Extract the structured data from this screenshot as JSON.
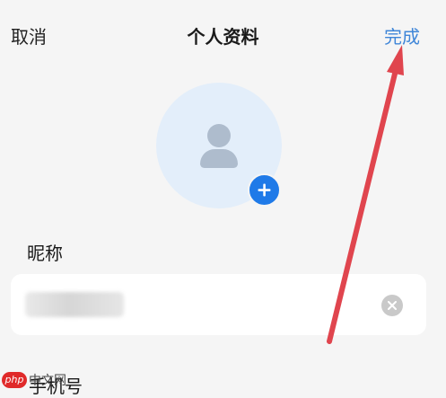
{
  "header": {
    "cancel_label": "取消",
    "title": "个人资料",
    "done_label": "完成"
  },
  "avatar": {
    "icon": "person-silhouette-icon",
    "add_icon": "plus-icon",
    "colors": {
      "circle_bg": "#e3eefa",
      "silhouette": "#aebccd",
      "add_badge": "#1f7ae8"
    }
  },
  "nickname": {
    "label": "昵称",
    "value": "",
    "clear_icon": "clear-circle-x-icon"
  },
  "next_field": {
    "label": "手机号"
  },
  "annotation": {
    "arrow_color": "#e0454e"
  },
  "watermark": {
    "logo_text": "php",
    "text": "中文网"
  },
  "colors": {
    "background": "#f5f5f5",
    "accent": "#3f86d8"
  }
}
